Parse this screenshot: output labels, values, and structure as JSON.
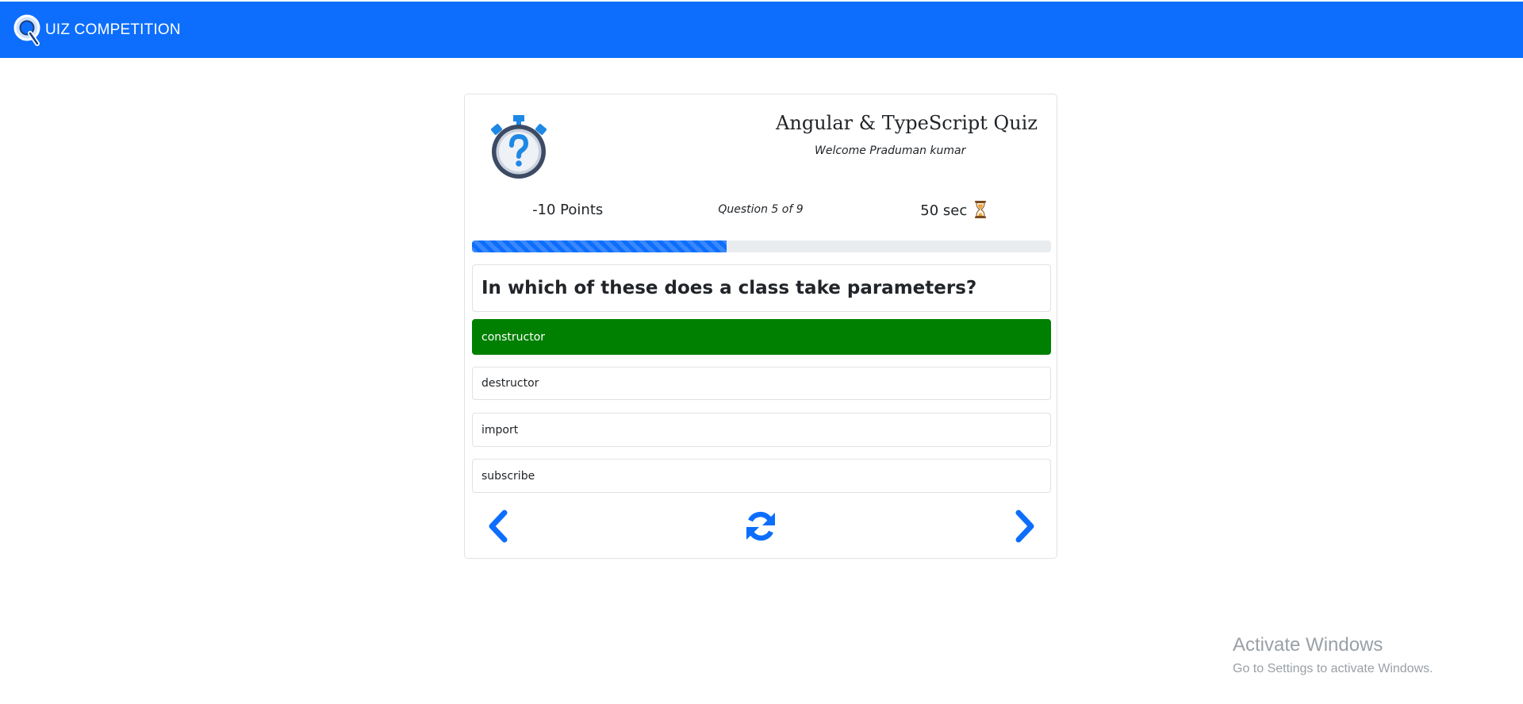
{
  "navbar": {
    "brand_text": "UIZ COMPETITION",
    "brand_logo_letter": "Q",
    "bg_color": "#0d6efd"
  },
  "quiz": {
    "title": "Angular & TypeScript Quiz",
    "welcome": "Welcome Praduman kumar",
    "points": "-10 Points",
    "question_counter": "Question 5 of 9",
    "timer": "50 sec",
    "progress_fraction": 0.44,
    "question": "In which of these does a class take parameters?",
    "options": [
      {
        "label": "constructor",
        "selected": true
      },
      {
        "label": "destructor",
        "selected": false
      },
      {
        "label": "import",
        "selected": false
      },
      {
        "label": "subscribe",
        "selected": false
      }
    ],
    "selected_color": "#008000",
    "accent_color": "#0d6efd",
    "icons": {
      "stopwatch": "stopwatch-question-icon",
      "timer": "hourglass-icon",
      "previous": "chevron-left-icon",
      "refresh": "refresh-icon",
      "next": "chevron-right-icon"
    }
  },
  "watermark": {
    "title": "Activate Windows",
    "subtitle": "Go to Settings to activate Windows."
  }
}
